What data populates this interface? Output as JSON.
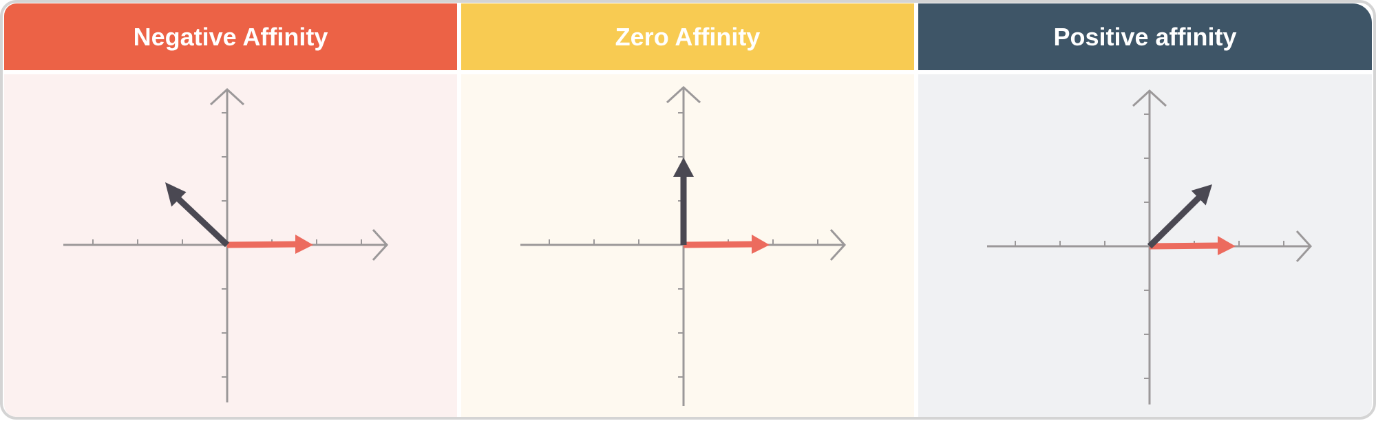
{
  "panels": [
    {
      "title": "Negative Affinity",
      "header_color": "#EC6246",
      "body_color": "#FCF1F0",
      "gray_vector_direction": "up-left (about 135°)",
      "red_vector_direction": "right (0°)"
    },
    {
      "title": "Zero Affinity",
      "header_color": "#F8CB52",
      "body_color": "#FEF9F0",
      "gray_vector_direction": "up (90°)",
      "red_vector_direction": "right (0°)"
    },
    {
      "title": "Positive affinity",
      "header_color": "#3E5567",
      "body_color": "#F0F1F3",
      "gray_vector_direction": "up-right (45°)",
      "red_vector_direction": "right (0°)"
    }
  ],
  "colors": {
    "axis": "#9B9899",
    "gray_vector": "#4A4852",
    "red_vector": "#EC6B5E",
    "outer_border": "#D4D4D4"
  },
  "icons": [
    "axis-arrow-icon",
    "vector-arrow-icon"
  ]
}
